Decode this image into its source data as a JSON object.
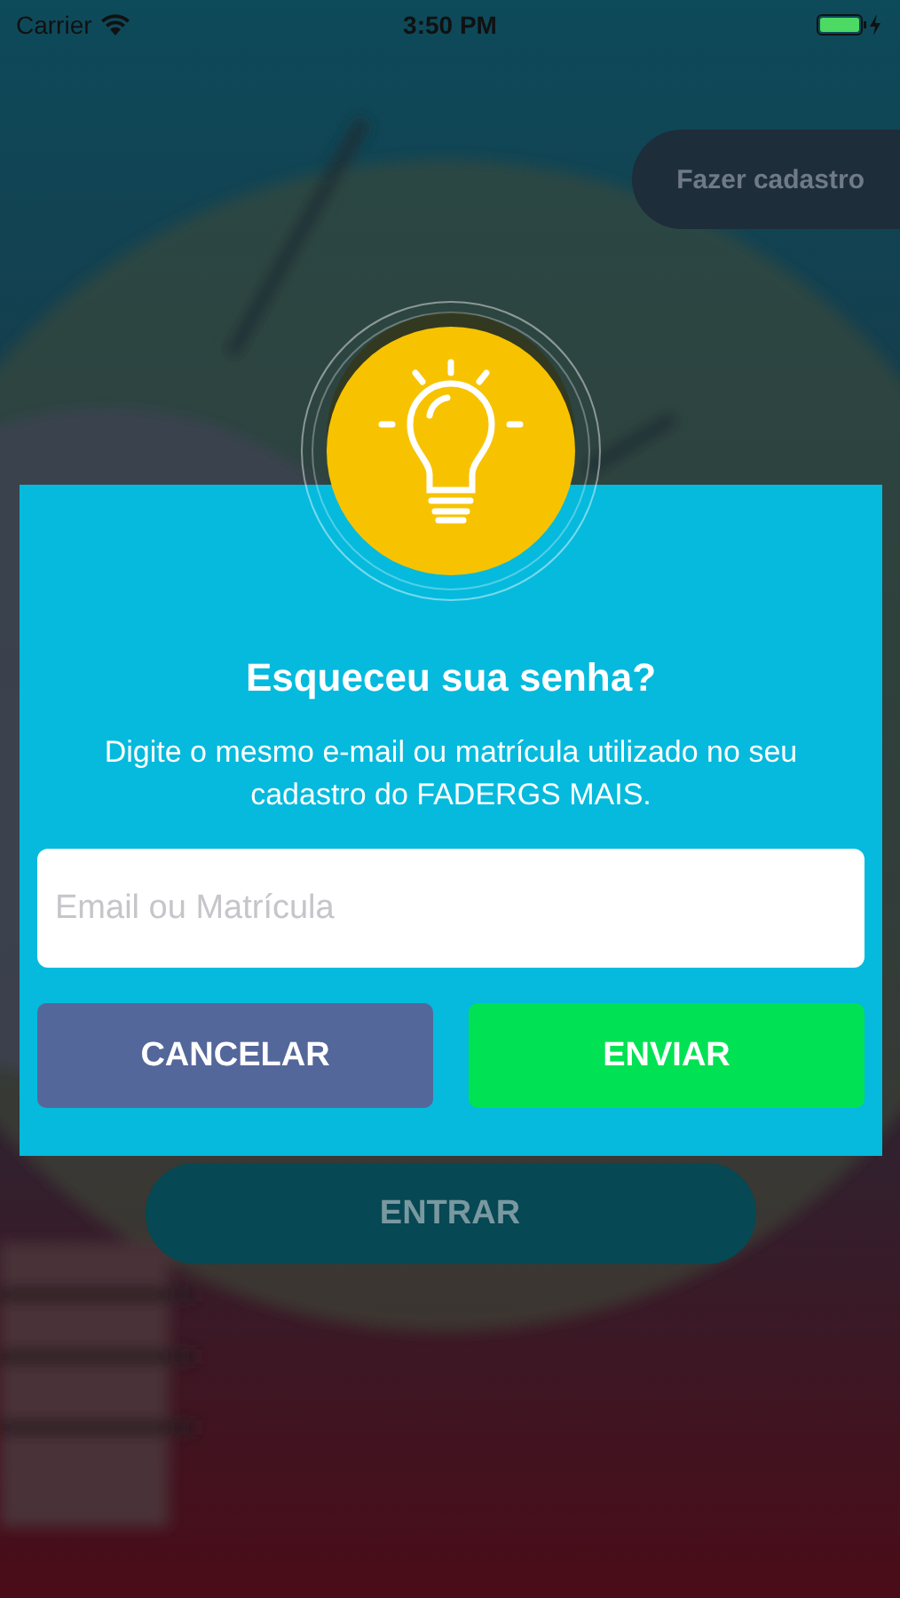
{
  "status_bar": {
    "carrier": "Carrier",
    "time": "3:50 PM"
  },
  "signup_button": {
    "label": "Fazer cadastro"
  },
  "dialog": {
    "title": "Esqueceu sua senha?",
    "description": "Digite o mesmo e-mail ou matrícula utilizado no seu cadastro do FADERGS MAIS.",
    "input": {
      "placeholder": "Email ou Matrícula"
    },
    "buttons": [
      {
        "label": "CANCELAR",
        "kind": "cancel"
      },
      {
        "label": "ENVIAR",
        "kind": "submit"
      }
    ]
  },
  "login_button": {
    "label": "ENTRAR"
  }
}
